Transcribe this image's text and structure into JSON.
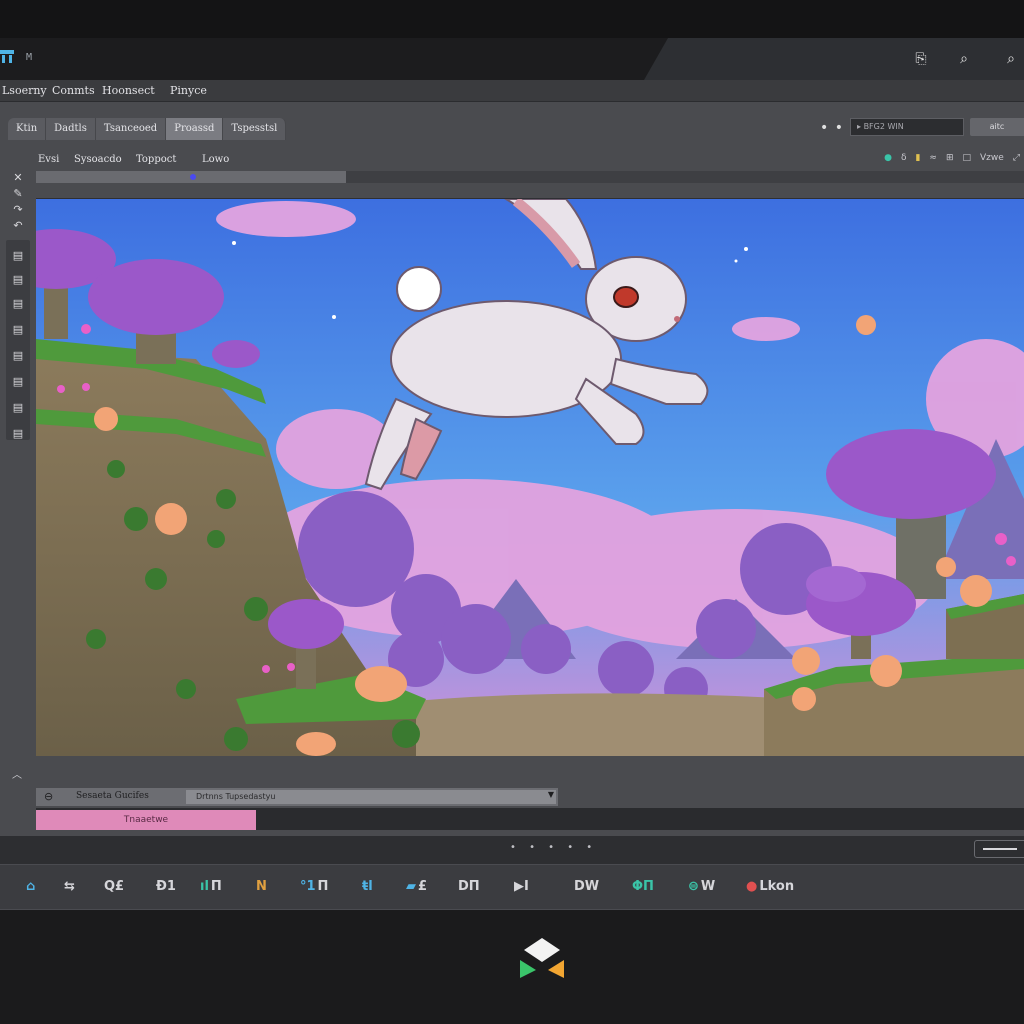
{
  "window": {
    "title": "M",
    "actions": [
      "save-icon",
      "search-icon",
      "search-icon"
    ]
  },
  "menu": {
    "items": [
      "Lsoerny",
      "Conmts",
      "Hoonsect",
      "Pinyce"
    ]
  },
  "tabs": [
    {
      "label": "Ktin"
    },
    {
      "label": "Dadtls"
    },
    {
      "label": "Tsanceoed"
    },
    {
      "label": "Proassd",
      "active": true
    },
    {
      "label": "Tspesstsl"
    }
  ],
  "toolbar": {
    "overflow": "• • •",
    "zoom_value": "BFG2 WIN",
    "button_label": "aitc"
  },
  "subbar": {
    "items": [
      "Evsi",
      "Sysoacdo",
      "Toppoct",
      "Lowo"
    ],
    "right_label": "Vzwe"
  },
  "timeline": {
    "label": "Sesaeta Gucifes",
    "field_value": "Drtnns Tupsedastyu",
    "clip_label": "Tnaaetwe"
  },
  "status": {
    "pager": "• • • • •"
  },
  "dock": [
    {
      "icon": "home-icon",
      "label": ""
    },
    {
      "icon": "undo-icon",
      "label": ""
    },
    {
      "icon": "zoom-icon",
      "label": "Q£"
    },
    {
      "icon": "frame-icon",
      "label": "Ð1"
    },
    {
      "icon": "chart-icon",
      "label": "ıl Π"
    },
    {
      "icon": "tile-icon",
      "label": "N"
    },
    {
      "icon": "layers-icon",
      "label": "°1 Π"
    },
    {
      "icon": "sprite-icon",
      "label": "ŧl"
    },
    {
      "icon": "camera-icon",
      "label": "£"
    },
    {
      "icon": "box-icon",
      "label": "DΠ"
    },
    {
      "icon": "play-icon",
      "label": "▶I"
    },
    {
      "icon": "window-icon",
      "label": "DW"
    },
    {
      "icon": "grid-icon",
      "label": "ΦΠ"
    },
    {
      "icon": "link-icon",
      "label": "W"
    },
    {
      "icon": "log-icon",
      "label": "Lkon"
    }
  ],
  "colors": {
    "accent_blue": "#4fb4e6",
    "accent_pink": "#df8ab9",
    "accent_teal": "#3ac4a8"
  }
}
